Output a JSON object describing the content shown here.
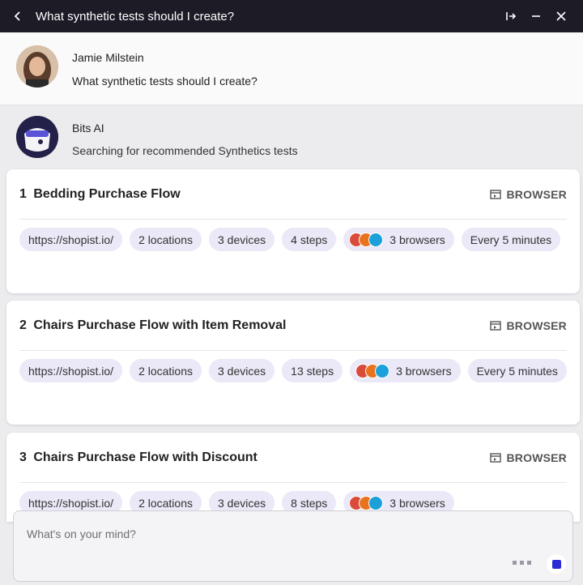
{
  "header": {
    "title": "What synthetic tests should I create?"
  },
  "user_message": {
    "name": "Jamie Milstein",
    "text": "What synthetic tests should I create?"
  },
  "bot_message": {
    "name": "Bits AI",
    "status": "Searching for recommended Synthetics tests"
  },
  "tests": [
    {
      "number": "1",
      "name": "Bedding Purchase Flow",
      "type": "BROWSER",
      "url": "https://shopist.io/",
      "locations": "2 locations",
      "devices": "3 devices",
      "steps": "4 steps",
      "browsers": "3 browsers",
      "frequency": "Every 5 minutes"
    },
    {
      "number": "2",
      "name": "Chairs Purchase Flow with Item Removal",
      "type": "BROWSER",
      "url": "https://shopist.io/",
      "locations": "2 locations",
      "devices": "3 devices",
      "steps": "13 steps",
      "browsers": "3 browsers",
      "frequency": "Every 5 minutes"
    },
    {
      "number": "3",
      "name": "Chairs Purchase Flow with Discount",
      "type": "BROWSER",
      "url": "https://shopist.io/",
      "locations": "2 locations",
      "devices": "3 devices",
      "steps": "8 steps",
      "browsers": "3 browsers",
      "frequency": ""
    }
  ],
  "composer": {
    "placeholder": "What's on your mind?"
  },
  "icons": {
    "back": "chevron-left-icon",
    "dock": "dock-right-icon",
    "minimize": "minimize-icon",
    "close": "close-icon",
    "browser": "browser-window-icon",
    "stop": "stop-icon"
  },
  "colors": {
    "titlebar": "#1c1b26",
    "chip": "#ebe8f7",
    "accent": "#2c2bd3"
  }
}
